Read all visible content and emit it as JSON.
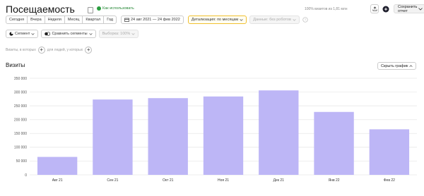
{
  "header": {
    "title": "Посещаемость",
    "howto": "Как использовать",
    "meta": "100% визитов из 1,81 млн",
    "save_label": "Сохранить отчет"
  },
  "periods": [
    "Сегодня",
    "Вчера",
    "Неделя",
    "Месяц",
    "Квартал",
    "Год"
  ],
  "date_range": "24 авг 2021 — 24 фев 2022",
  "detail": "Детализация: по месяцам",
  "bots": "Данные: без роботов",
  "segment": "Сегмент",
  "compare": "Сравнить сегменты",
  "sample": "Выборка: 100%",
  "filters": {
    "visits": "Визиты, в которых",
    "people": "для людей, у которых"
  },
  "section": {
    "title": "Визиты",
    "hide": "Скрыть график"
  },
  "chart_data": {
    "type": "bar",
    "categories": [
      "Авг 21",
      "Сен 21",
      "Окт 21",
      "Ноя 21",
      "Дек 21",
      "Янв 22",
      "Фев 22"
    ],
    "values": [
      65000,
      273000,
      278000,
      284000,
      306000,
      228000,
      165000
    ],
    "ylim": [
      0,
      350000
    ],
    "yticks": [
      0,
      50000,
      100000,
      150000,
      200000,
      250000,
      300000,
      350000
    ],
    "ytick_labels": [
      "0",
      "50 000",
      "100 000",
      "150 000",
      "200 000",
      "250 000",
      "300 000",
      "350 000"
    ],
    "bar_color": "#bdb6f6",
    "grid": true
  }
}
